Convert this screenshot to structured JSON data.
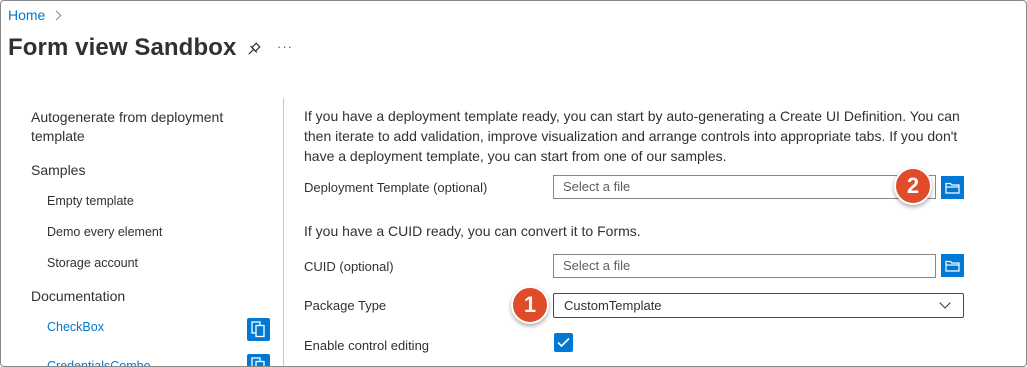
{
  "breadcrumb": {
    "home": "Home"
  },
  "page": {
    "title": "Form view Sandbox"
  },
  "sidebar": {
    "autogen": "Autogenerate from deployment template",
    "samples_header": "Samples",
    "samples": [
      "Empty template",
      "Demo every element",
      "Storage account"
    ],
    "docs_header": "Documentation",
    "docs": [
      "CheckBox",
      "CredentialsCombo"
    ]
  },
  "main": {
    "intro": "If you have a deployment template ready, you can start by auto-generating a Create UI Definition. You can then iterate to add validation, improve visualization and arrange controls into appropriate tabs. If you don't have a deployment template, you can start from one of our samples.",
    "deployment_label": "Deployment Template (optional)",
    "deployment_placeholder": "Select a file",
    "cuid_intro": "If you have a CUID ready, you can convert it to Forms.",
    "cuid_label": "CUID (optional)",
    "cuid_placeholder": "Select a file",
    "package_label": "Package Type",
    "package_value": "CustomTemplate",
    "enable_label": "Enable control editing",
    "enable_checked": true
  },
  "callouts": {
    "one": "1",
    "two": "2"
  },
  "colors": {
    "accent": "#0078d4",
    "callout": "#e04b2a",
    "select_border": "#6b2d7a"
  }
}
